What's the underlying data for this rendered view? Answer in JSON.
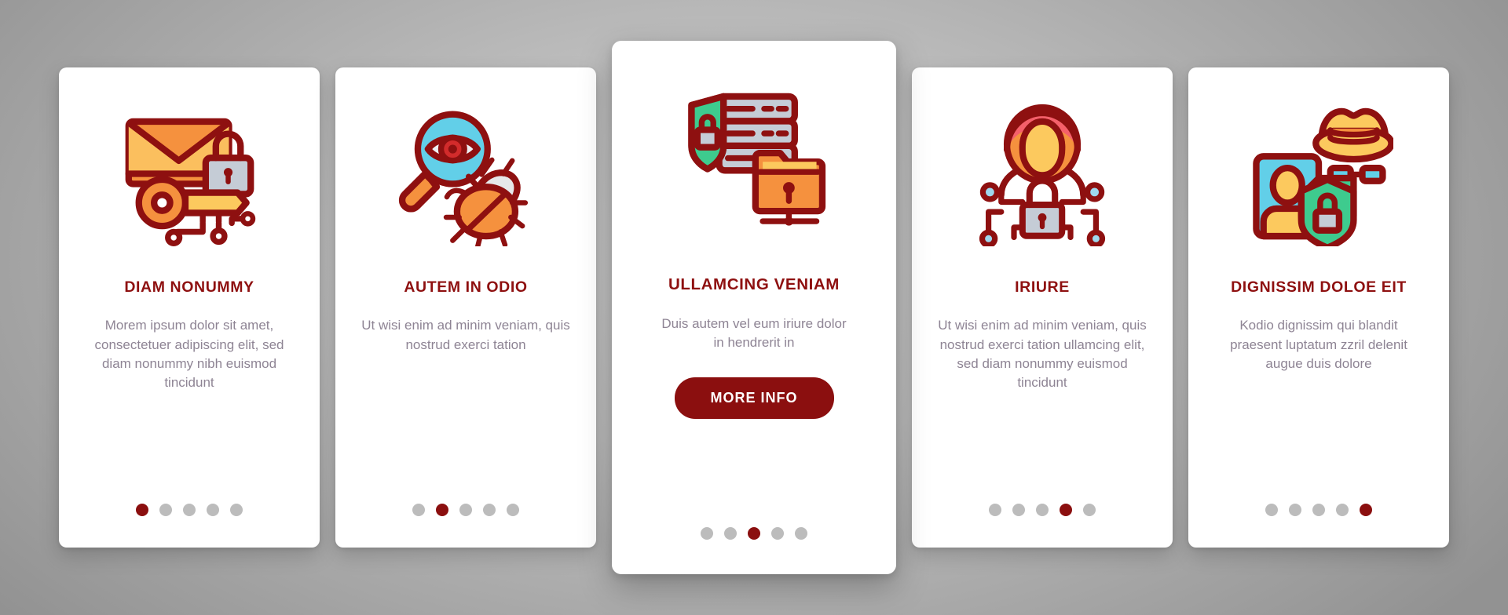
{
  "background": {
    "color_center": "#c9c9c9",
    "color_edge": "#929292"
  },
  "theme": {
    "accent": "#8b0f0f",
    "title_color": "#8e1010",
    "body_text_color": "#8e8494",
    "card_bg": "#ffffff",
    "dot_inactive": "#bcbcbc",
    "icon_outline": "#8e1010",
    "icon_orange": "#f5913e",
    "icon_orange_light": "#fbbf5e",
    "icon_yellow": "#fcc95e",
    "icon_cyan": "#62cfe8",
    "icon_green": "#3ecb8e",
    "icon_grey_blue": "#c5ccd6",
    "icon_pink": "#f4606a"
  },
  "cards": [
    {
      "icon_name": "encrypted-email-key-icon",
      "title": "DIAM NONUMMY",
      "description": "Morem ipsum dolor sit amet, consectetuer adipiscing elit, sed diam nonummy nibh euismod tincidunt",
      "has_button": false,
      "button_label": null,
      "dots": {
        "count": 5,
        "active_index": 0
      },
      "featured": false
    },
    {
      "icon_name": "spyware-detection-magnifier-bug-icon",
      "title": "AUTEM IN ODIO",
      "description": "Ut wisi enim ad minim veniam, quis nostrud exerci tation",
      "has_button": false,
      "button_label": null,
      "dots": {
        "count": 5,
        "active_index": 1
      },
      "featured": false
    },
    {
      "icon_name": "secure-server-folder-shield-icon",
      "title": "ULLAMCING VENIAM",
      "description": "Duis autem vel eum iriure dolor in hendrerit in",
      "has_button": true,
      "button_label": "MORE INFO",
      "dots": {
        "count": 5,
        "active_index": 2
      },
      "featured": true
    },
    {
      "icon_name": "hacker-network-lock-icon",
      "title": "IRIURE",
      "description": "Ut wisi enim ad minim veniam, quis nostrud exerci tation ullamcing elit, sed diam nonummy euismod tincidunt",
      "has_button": false,
      "button_label": null,
      "dots": {
        "count": 5,
        "active_index": 3
      },
      "featured": false
    },
    {
      "icon_name": "identity-privacy-spy-icon",
      "title": "DIGNISSIM DOLOE EIT",
      "description": "Kodio dignissim qui blandit praesent luptatum zzril delenit augue duis dolore",
      "has_button": false,
      "button_label": null,
      "dots": {
        "count": 5,
        "active_index": 4
      },
      "featured": false
    }
  ]
}
